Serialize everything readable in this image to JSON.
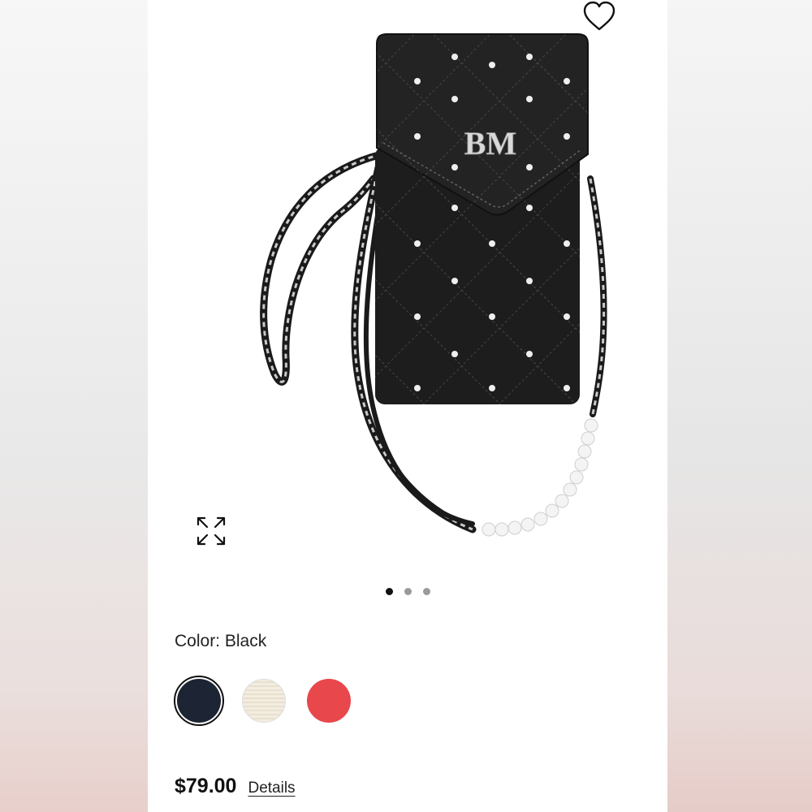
{
  "product": {
    "color_label": "Color: Black",
    "price": "$79.00",
    "details_link": "Details",
    "brand_monogram": "BM"
  },
  "gallery": {
    "image_count": 3,
    "active_index": 0
  },
  "swatches": [
    {
      "name": "Black",
      "color": "#1d2433",
      "selected": true
    },
    {
      "name": "Cream",
      "color": "#f1ebdc",
      "selected": false
    },
    {
      "name": "Red",
      "color": "#e8474c",
      "selected": false
    }
  ],
  "icons": {
    "favorite": "heart-icon",
    "expand": "expand-icon"
  },
  "colors": {
    "bag": "#1c1c1c",
    "text": "#222222"
  }
}
